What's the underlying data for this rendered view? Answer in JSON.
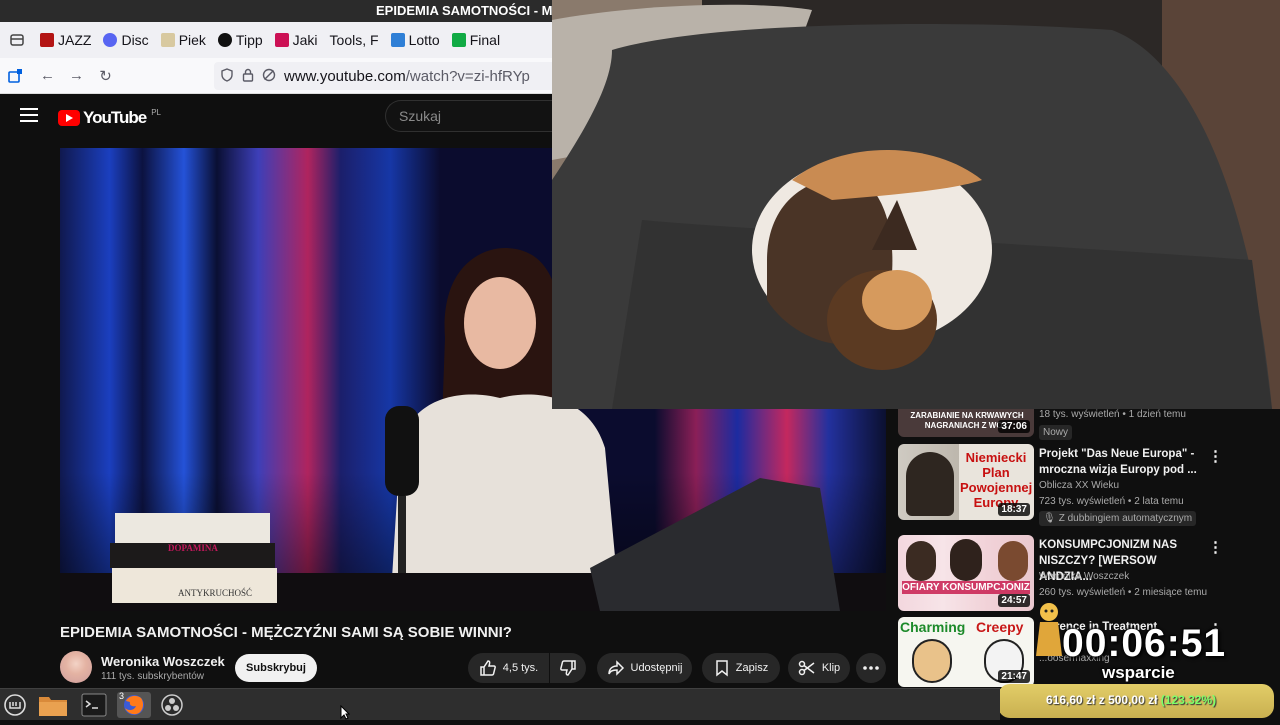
{
  "window": {
    "title": "EPIDEMIA SAMOTNOŚCI - MĘŻ"
  },
  "browser": {
    "bookmarks": [
      {
        "label": "JAZZ",
        "color": "#b31414"
      },
      {
        "label": "Disc",
        "color": "#5865f2"
      },
      {
        "label": "Piek",
        "color": "#d8c9a0"
      },
      {
        "label": "Tipp",
        "color": "#111111"
      },
      {
        "label": "Jaki",
        "color": "#cc1155"
      },
      {
        "label": "Tools, F",
        "color": ""
      },
      {
        "label": "Lotto",
        "color": "#2f7fd6"
      },
      {
        "label": "Final",
        "color": "#11aa44"
      }
    ],
    "url_host": "www.youtube.com",
    "url_path": "/watch?v=zi-hfRYp"
  },
  "youtube": {
    "logo": "YouTube",
    "region": "PL",
    "search_placeholder": "Szukaj",
    "video_title": "EPIDEMIA SAMOTNOŚCI - MĘŻCZYŹNI SAMI SĄ SOBIE WINNI?",
    "channel": "Weronika Woszczek",
    "subscribers": "111 tys. subskrybentów",
    "subscribe": "Subskrybuj",
    "actions": {
      "likes": "4,5 tys.",
      "share": "Udostępnij",
      "save": "Zapisz",
      "clip": "Klip"
    },
    "book_titles": [
      "DOPAMINA",
      "ANTYKRUCHOŚĆ"
    ],
    "recommended": [
      {
        "thumb_text": "ZARABIANIE NA KRWAWYCH NAGRANIACH Z WO...",
        "duration": "37:06",
        "meta": "18 tys. wyświetleń • 1 dzień temu",
        "badge": "Nowy"
      },
      {
        "title": "Projekt \"Das Neue Europa\" - mroczna wizja Europy pod ...",
        "thumb_text": "Niemiecki Plan Powojennej Europy",
        "channel": "Oblicza XX Wieku",
        "meta": "723 tys. wyświetleń • 2 lata temu",
        "duration": "18:37",
        "badge": "Z dubbingiem automatycznym"
      },
      {
        "title": "KONSUMPCJONIZM NAS NISZCZY? [WERSOW ANDZIA...",
        "thumb_text": "OFIARY KONSUMPCJONIZ",
        "channel": "Weronika Woszczek",
        "meta": "260 tys. wyświetleń • 2 miesiące temu",
        "duration": "24:57"
      },
      {
        "title": "...erence in Treatment",
        "thumb_text_a": "Charming",
        "thumb_text_b": "Creepy",
        "channel": "...oosermaxxing",
        "duration": "21:47"
      }
    ]
  },
  "overlay": {
    "timer": "00:06:51",
    "support_label": "wsparcie",
    "goal_current": "616,60 zł",
    "goal_sep": "z",
    "goal_target": "500,00 zł",
    "goal_percent": "(123.32%)"
  },
  "taskbar": {
    "firefox_windows": "3"
  },
  "icons": {
    "menu": "menu-icon",
    "search": "search-icon",
    "like": "thumbs-up-icon",
    "dislike": "thumbs-down-icon",
    "share": "share-icon",
    "save": "bookmark-icon",
    "clip": "scissors-icon",
    "more": "more-icon"
  }
}
